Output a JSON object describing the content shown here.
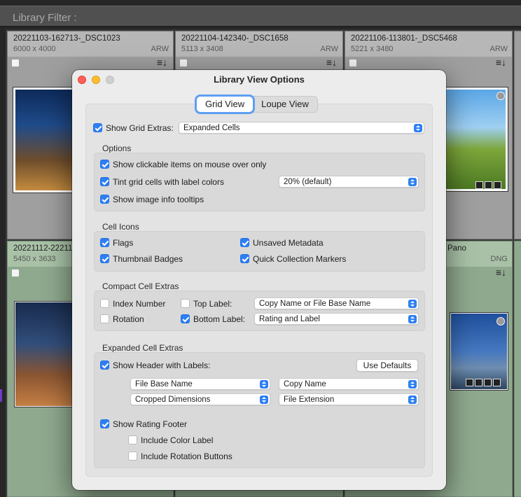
{
  "background": {
    "filter_bar_title": "Library Filter :",
    "cells": [
      {
        "name": "20221103-162713-_DSC1023",
        "dims": "6000 x 4000",
        "ext": "ARW"
      },
      {
        "name": "20221104-142340-_DSC1658",
        "dims": "5113 x 3408",
        "ext": "ARW"
      },
      {
        "name": "20221106-113801-_DSC5468",
        "dims": "5221 x 3480",
        "ext": "ARW"
      },
      {
        "name": "20221112-222119-",
        "dims": "5450 x 3633",
        "ext": ""
      },
      {
        "name": "Pano",
        "dims": "",
        "ext": "DNG"
      }
    ],
    "sort_icon": "≡↓"
  },
  "dialog": {
    "title": "Library View Options",
    "tabs": [
      {
        "label": "Grid View",
        "active": true
      },
      {
        "label": "Loupe View",
        "active": false
      }
    ],
    "show_grid_extras": {
      "label": "Show Grid Extras:",
      "checked": true,
      "value": "Expanded Cells"
    },
    "options": {
      "title": "Options",
      "clickable_items": {
        "label": "Show clickable items on mouse over only",
        "checked": true
      },
      "tint_cells": {
        "label": "Tint grid cells with label colors",
        "checked": true,
        "value": "20% (default)"
      },
      "tooltips": {
        "label": "Show image info tooltips",
        "checked": true
      }
    },
    "cell_icons": {
      "title": "Cell Icons",
      "flags": {
        "label": "Flags",
        "checked": true
      },
      "thumbnail_badges": {
        "label": "Thumbnail Badges",
        "checked": true
      },
      "unsaved_metadata": {
        "label": "Unsaved Metadata",
        "checked": true
      },
      "quick_collection": {
        "label": "Quick Collection Markers",
        "checked": true
      }
    },
    "compact": {
      "title": "Compact Cell Extras",
      "index_number": {
        "label": "Index Number",
        "checked": false
      },
      "rotation": {
        "label": "Rotation",
        "checked": false
      },
      "top_label": {
        "label": "Top Label:",
        "checked": false,
        "value": "Copy Name or File Base Name"
      },
      "bottom_label": {
        "label": "Bottom Label:",
        "checked": true,
        "value": "Rating and Label"
      }
    },
    "expanded": {
      "title": "Expanded Cell Extras",
      "header_labels": {
        "label": "Show Header with Labels:",
        "checked": true
      },
      "use_defaults": "Use Defaults",
      "field1": "File Base Name",
      "field2": "Copy Name",
      "field3": "Cropped Dimensions",
      "field4": "File Extension",
      "rating_footer": {
        "label": "Show Rating Footer",
        "checked": true
      },
      "color_label": {
        "label": "Include Color Label",
        "checked": false
      },
      "rotation_buttons": {
        "label": "Include Rotation Buttons",
        "checked": false
      }
    }
  },
  "colors": {
    "accent": "#2d7ff4",
    "close": "#fe5f57",
    "minimize": "#febc2e",
    "zoom": "#d0d0d0",
    "label_green": "#8fa98e"
  }
}
